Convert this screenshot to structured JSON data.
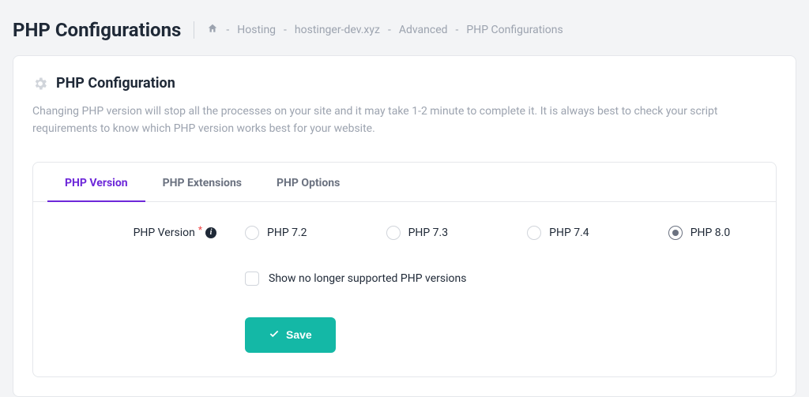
{
  "page_title": "PHP Configurations",
  "breadcrumb": {
    "items": [
      "Hosting",
      "hostinger-dev.xyz",
      "Advanced",
      "PHP Configurations"
    ]
  },
  "card": {
    "title": "PHP Configuration",
    "description": "Changing PHP version will stop all the processes on your site and it may take 1-2 minute to complete it. It is always best to check your script requirements to know which PHP version works best for your website."
  },
  "tabs": [
    {
      "label": "PHP Version",
      "active": true
    },
    {
      "label": "PHP Extensions",
      "active": false
    },
    {
      "label": "PHP Options",
      "active": false
    }
  ],
  "form": {
    "label": "PHP Version",
    "options": [
      {
        "label": "PHP 7.2",
        "selected": false
      },
      {
        "label": "PHP 7.3",
        "selected": false
      },
      {
        "label": "PHP 7.4",
        "selected": false
      },
      {
        "label": "PHP 8.0",
        "selected": true
      }
    ],
    "checkbox_label": "Show no longer supported PHP versions",
    "save_label": "Save"
  }
}
